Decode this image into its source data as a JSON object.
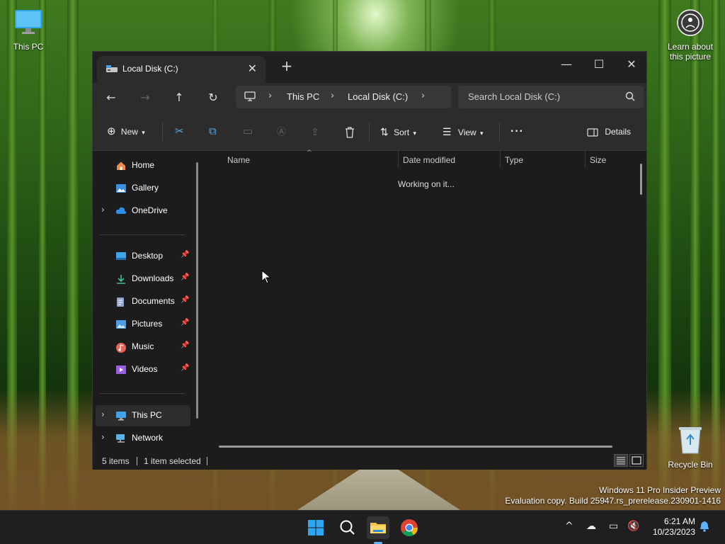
{
  "desktop": {
    "icons": [
      {
        "label": "This PC"
      },
      {
        "label": "Learn about this picture"
      },
      {
        "label": "Recycle Bin"
      }
    ],
    "watermark": {
      "line1": "Windows 11 Pro Insider Preview",
      "line2": "Evaluation copy. Build 25947.rs_prerelease.230901-1416"
    }
  },
  "window": {
    "tab_title": "Local Disk (C:)",
    "address": {
      "segments": [
        "This PC",
        "Local Disk (C:)"
      ]
    },
    "search_placeholder": "Search Local Disk (C:)",
    "toolbar": {
      "new_label": "New",
      "sort_label": "Sort",
      "view_label": "View",
      "details_label": "Details"
    },
    "sidebar": {
      "items": [
        {
          "label": "Home"
        },
        {
          "label": "Gallery"
        },
        {
          "label": "OneDrive"
        },
        {
          "label": "Desktop"
        },
        {
          "label": "Downloads"
        },
        {
          "label": "Documents"
        },
        {
          "label": "Pictures"
        },
        {
          "label": "Music"
        },
        {
          "label": "Videos"
        },
        {
          "label": "This PC"
        },
        {
          "label": "Network"
        }
      ]
    },
    "columns": [
      "Name",
      "Date modified",
      "Type",
      "Size"
    ],
    "loading_message": "Working on it...",
    "status": {
      "items_count": "5 items",
      "selected": "1 item selected"
    }
  },
  "taskbar": {
    "time": "6:21 AM",
    "date": "10/23/2023"
  },
  "colors": {
    "accent": "#0078d4",
    "window_bg": "#1c1c1c",
    "toolbar_bg": "#2c2c2c"
  }
}
